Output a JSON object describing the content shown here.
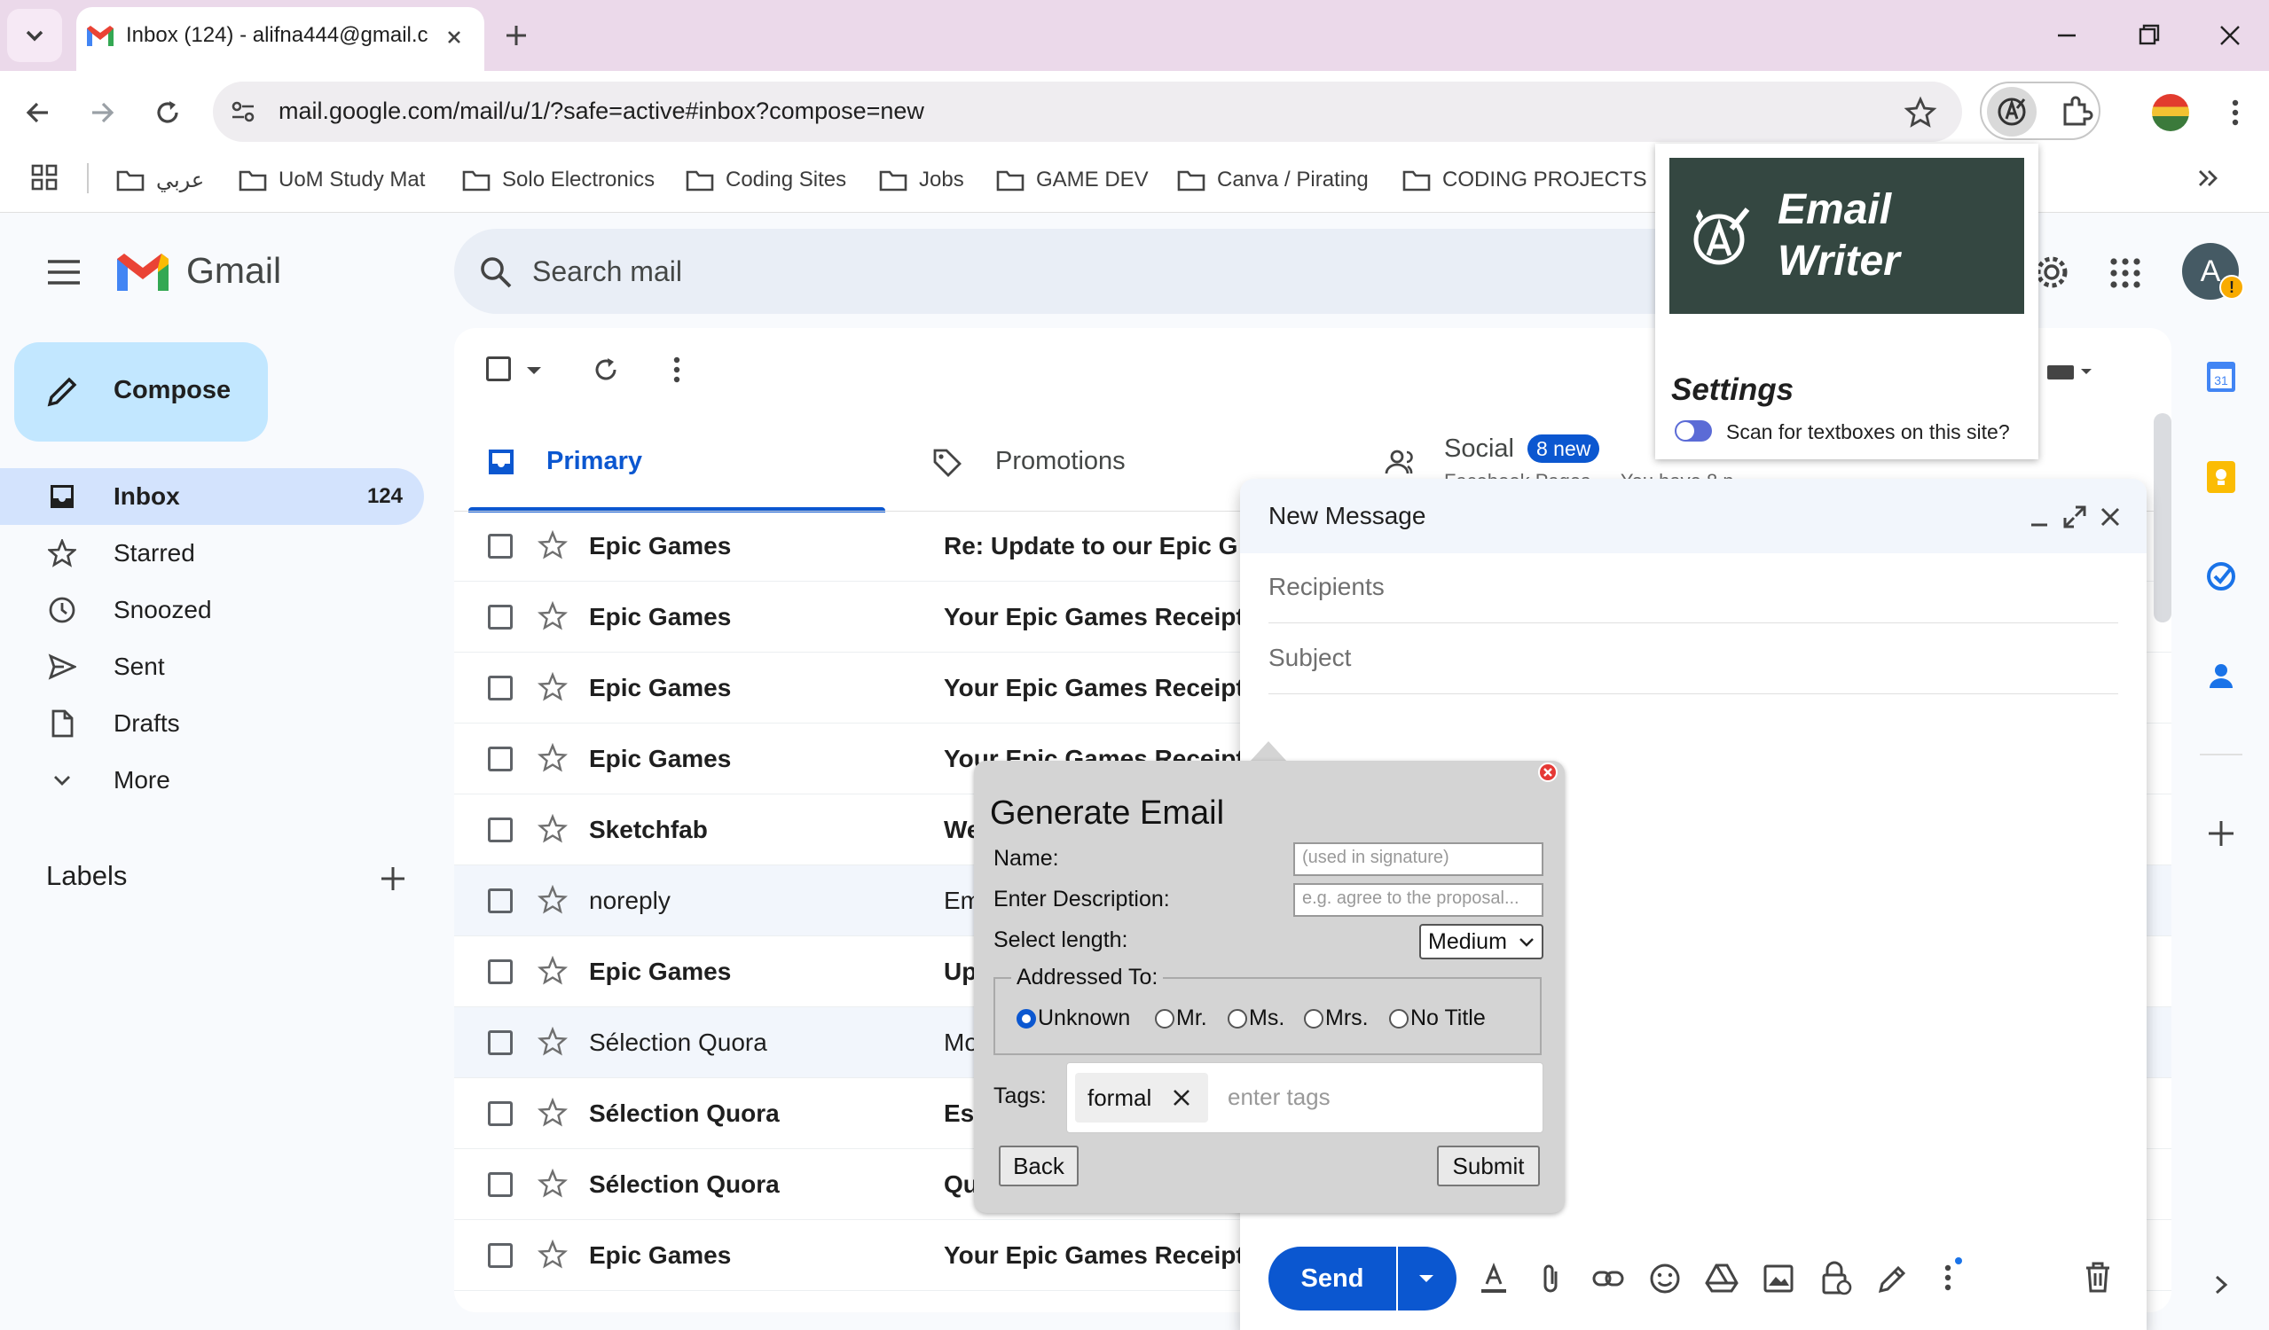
{
  "browser": {
    "tab_title": "Inbox (124) - alifna444@gmail.c",
    "url": "mail.google.com/mail/u/1/?safe=active#inbox?compose=new",
    "bookmarks": [
      "عربي",
      "UoM Study Mat",
      "Solo Electronics",
      "Coding Sites",
      "Jobs",
      "GAME DEV",
      "Canva / Pirating",
      "CODING PROJECTS"
    ]
  },
  "gmail": {
    "logo_text": "Gmail",
    "search_placeholder": "Search mail",
    "compose_label": "Compose",
    "nav": [
      {
        "label": "Inbox",
        "count": "124"
      },
      {
        "label": "Starred"
      },
      {
        "label": "Snoozed"
      },
      {
        "label": "Sent"
      },
      {
        "label": "Drafts"
      },
      {
        "label": "More"
      }
    ],
    "labels_heading": "Labels",
    "account_initial": "A",
    "tabs": {
      "primary": "Primary",
      "promotions": "Promotions",
      "social": "Social",
      "social_badge": "8 new",
      "social_snippet": "Facebook Pages … You have 8 n"
    },
    "emails": [
      {
        "sender": "Epic Games",
        "subject": "Re: Update to our Epic G",
        "unread": true
      },
      {
        "sender": "Epic Games",
        "subject": "Your Epic Games Receipt",
        "unread": true
      },
      {
        "sender": "Epic Games",
        "subject": "Your Epic Games Receipt",
        "unread": true
      },
      {
        "sender": "Epic Games",
        "subject": "Your Epic Games Receipt",
        "unread": true
      },
      {
        "sender": "Sketchfab",
        "subject": "We",
        "unread": true
      },
      {
        "sender": "noreply",
        "subject": "Em",
        "unread": false
      },
      {
        "sender": "Epic Games",
        "subject": "Up",
        "unread": true
      },
      {
        "sender": "Sélection Quora",
        "subject": "Mo",
        "unread": false
      },
      {
        "sender": "Sélection Quora",
        "subject": "Es",
        "unread": true
      },
      {
        "sender": "Sélection Quora",
        "subject": "Qu",
        "unread": true
      },
      {
        "sender": "Epic Games",
        "subject": "Your Epic Games Receipt",
        "unread": true
      }
    ]
  },
  "compose": {
    "title": "New Message",
    "recipients_placeholder": "Recipients",
    "subject_placeholder": "Subject",
    "send_label": "Send"
  },
  "extension": {
    "title_line1": "Email",
    "title_line2": "Writer",
    "settings_heading": "Settings",
    "scan_toggle_label": "Scan for textboxes on this site?",
    "scan_enabled": true
  },
  "generate_dialog": {
    "title": "Generate Email",
    "name_label": "Name:",
    "name_placeholder": "(used in signature)",
    "description_label": "Enter Description:",
    "description_placeholder": "e.g. agree to the proposal...",
    "length_label": "Select length:",
    "length_value": "Medium",
    "addressed_legend": "Addressed To:",
    "titles": [
      "Unknown",
      "Mr.",
      "Ms.",
      "Mrs.",
      "No Title"
    ],
    "selected_title": "Unknown",
    "tags_label": "Tags:",
    "tags": [
      "formal"
    ],
    "tags_placeholder": "enter tags",
    "back_label": "Back",
    "submit_label": "Submit"
  }
}
